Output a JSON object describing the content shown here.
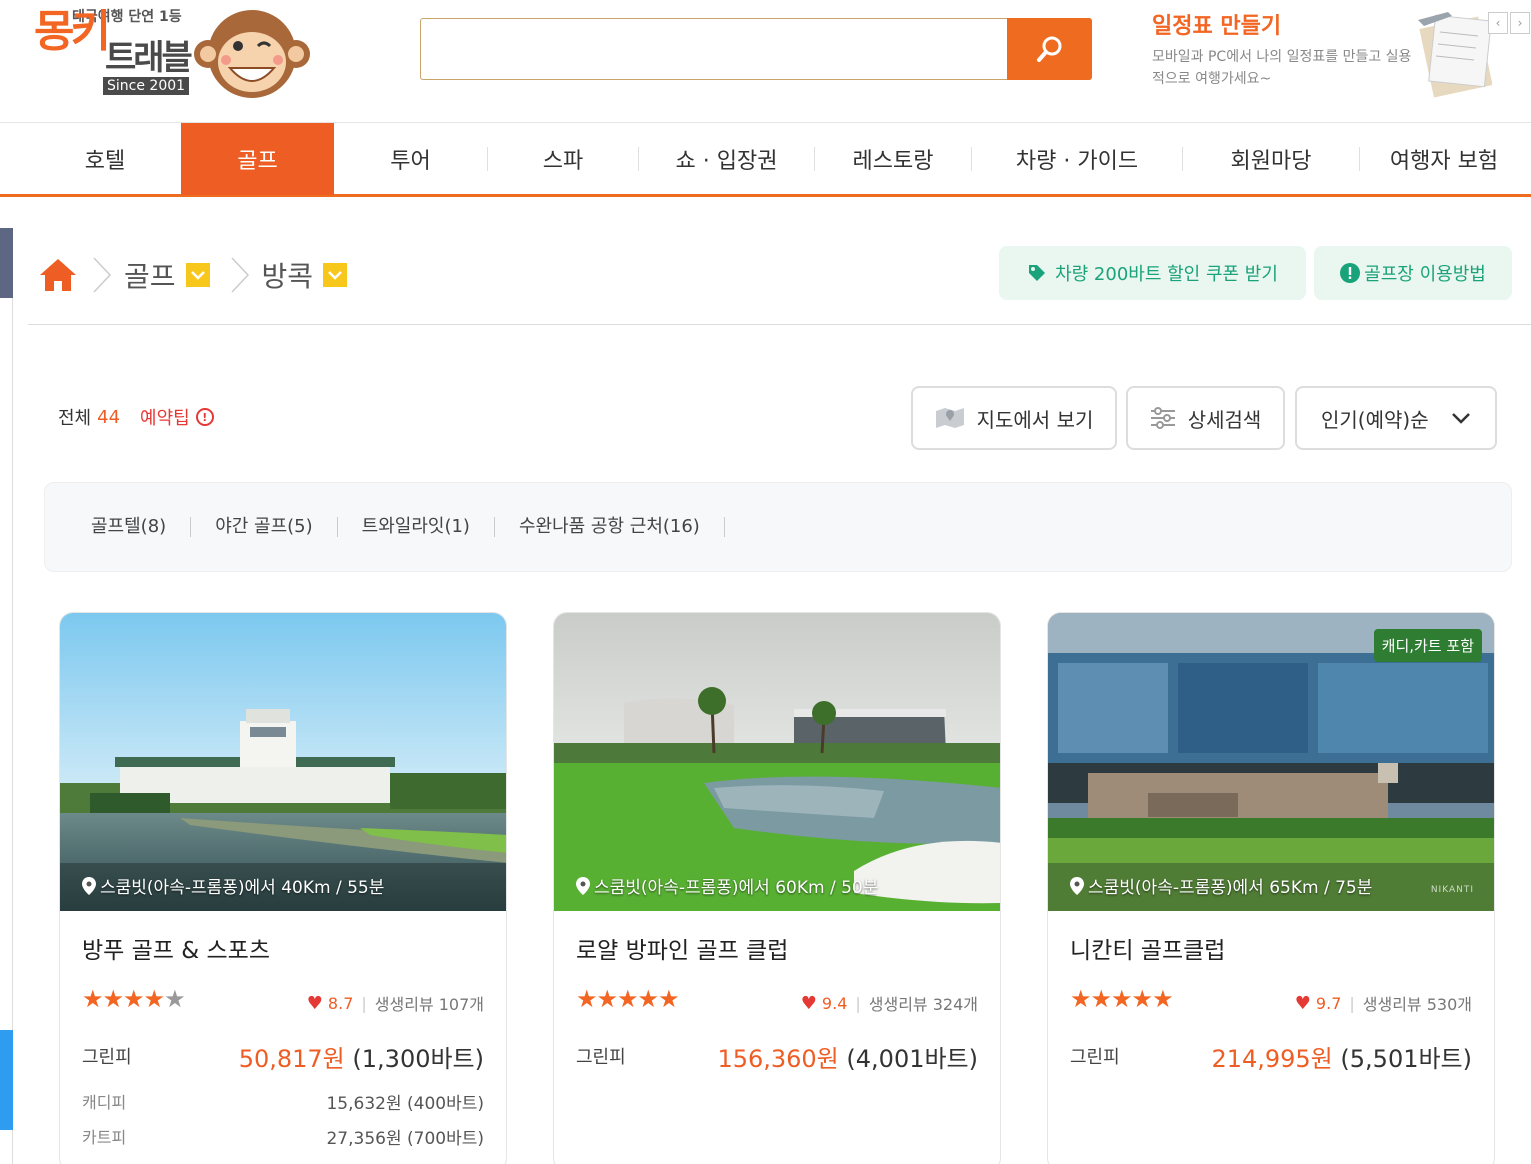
{
  "header": {
    "logo_main": "몽키",
    "logo_sub": "트래블",
    "logo_tag": "태국여행 단연 1등",
    "logo_since": "Since 2001",
    "search_placeholder": "",
    "planner_title": "일정표 만들기",
    "planner_desc": "모바일과 PC에서 나의 일정표를 만들고 실용적으로 여행가세요~"
  },
  "nav": {
    "items": [
      "호텔",
      "골프",
      "투어",
      "스파",
      "쇼 · 입장권",
      "레스토랑",
      "차량 · 가이드",
      "회원마당",
      "여행자 보험"
    ],
    "active": "골프"
  },
  "breadcrumb": {
    "level1": "골프",
    "level2": "방콕"
  },
  "actions": {
    "coupon": "차량 200바트 할인 쿠폰 받기",
    "guide": "골프장 이용방법"
  },
  "summary": {
    "total_label": "전체",
    "total_count": "44",
    "tip": "예약팁"
  },
  "tools": {
    "map": "지도에서 보기",
    "detail": "상세검색",
    "sort": "인기(예약)순"
  },
  "filters": [
    "골프텔(8)",
    "야간 골프(5)",
    "트와일라잇(1)",
    "수완나품 공항 근처(16)"
  ],
  "cards": [
    {
      "title": "방푸 골프 & 스포츠",
      "location": "스쿰빗(아속-프롬퐁)에서 40Km / 55분",
      "stars": 4,
      "score": "8.7",
      "reviews": "생생리뷰 107개",
      "green_label": "그린피",
      "green_krw": "50,817원",
      "green_thb": "(1,300바트)",
      "caddie_label": "캐디피",
      "caddie_price": "15,632원 (400바트)",
      "cart_label": "카트피",
      "cart_price": "27,356원 (700바트)",
      "badge": ""
    },
    {
      "title": "로얄 방파인 골프 클럽",
      "location": "스쿰빗(아속-프롬퐁)에서 60Km / 50분",
      "stars": 5,
      "score": "9.4",
      "reviews": "생생리뷰 324개",
      "green_label": "그린피",
      "green_krw": "156,360원",
      "green_thb": "(4,001바트)",
      "badge": ""
    },
    {
      "title": "니칸티 골프클럽",
      "location": "스쿰빗(아속-프롬퐁)에서 65Km / 75분",
      "stars": 5,
      "score": "9.7",
      "reviews": "생생리뷰 530개",
      "green_label": "그린피",
      "green_krw": "214,995원",
      "green_thb": "(5,501바트)",
      "badge": "캐디,카트 포함",
      "watermark": "NIKANTI"
    }
  ],
  "colors": {
    "brand": "#ee6b1f",
    "accent": "#ee5d24",
    "green": "#1aa37a",
    "star_yellow": "#f8c71b"
  }
}
